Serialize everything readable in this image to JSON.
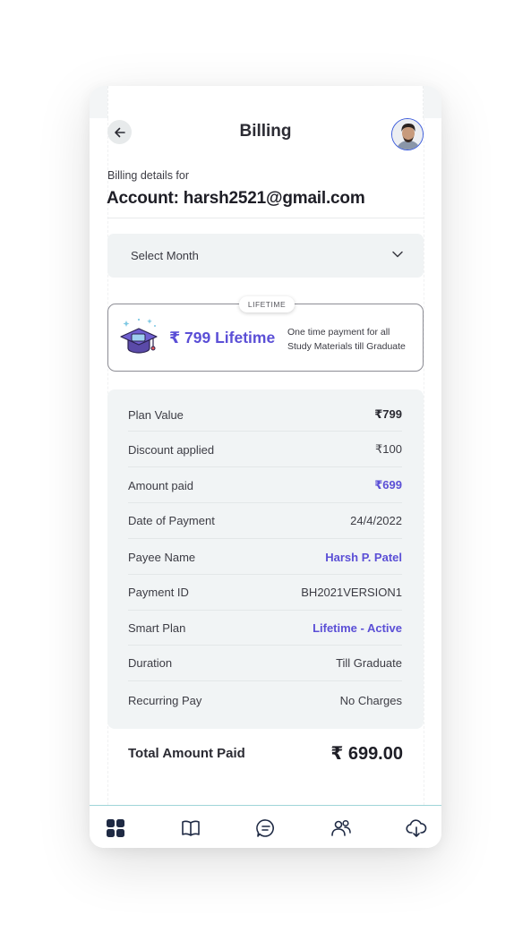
{
  "header": {
    "title": "Billing",
    "back_icon": "arrow-left-icon",
    "avatar_icon": "user-avatar"
  },
  "account": {
    "prefix": "Billing details for",
    "title": "Account: harsh2521@gmail.com"
  },
  "month_select": {
    "label": "Select Month",
    "icon": "chevron-down-icon"
  },
  "plan_card": {
    "badge": "LIFETIME",
    "price": "₹ 799 Lifetime",
    "note_line1": "One time payment for all",
    "note_line2": "Study Materials till Graduate",
    "icon": "graduation-cap-icon"
  },
  "details": {
    "rows": [
      {
        "label": "Plan Value",
        "value": "₹799"
      },
      {
        "label": "Discount applied",
        "value": "₹100"
      },
      {
        "label": "Amount paid",
        "value": "₹699"
      },
      {
        "label": "Date of Payment",
        "value": "24/4/2022"
      },
      {
        "label": "Payee Name",
        "value": "Harsh P. Patel"
      },
      {
        "label": "Payment ID",
        "value": "BH2021VERSION1"
      },
      {
        "label": "Smart Plan",
        "value": "Lifetime - Active"
      },
      {
        "label": "Duration",
        "value": "Till Graduate"
      },
      {
        "label": "Recurring Pay",
        "value": "No Charges"
      }
    ]
  },
  "total": {
    "label": "Total Amount Paid",
    "amount": "₹ 699.00"
  },
  "bottom_nav": {
    "items": [
      "dashboard-icon",
      "book-icon",
      "chat-icon",
      "people-icon",
      "cloud-download-icon"
    ]
  },
  "colors": {
    "accent": "#5b4fd6",
    "text": "#2a2a32",
    "panel": "#f1f4f5",
    "nav_active": "#1f2a44"
  }
}
